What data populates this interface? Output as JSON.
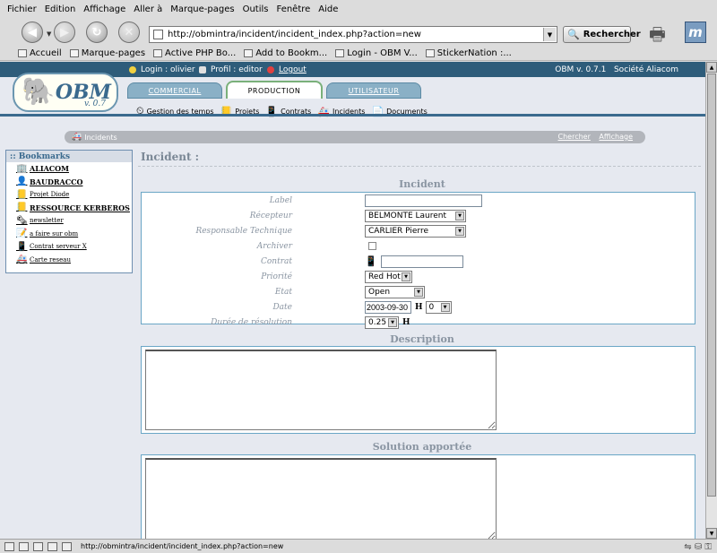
{
  "browser": {
    "menu": [
      "Fichier",
      "Edition",
      "Affichage",
      "Aller à",
      "Marque-pages",
      "Outils",
      "Fenêtre",
      "Aide"
    ],
    "url": "http://obmintra/incident/incident_index.php?action=new",
    "search_label": "Rechercher",
    "bookmarks": [
      "Accueil",
      "Marque-pages",
      "Active PHP Bo...",
      "Add to Bookm...",
      "Login - OBM V...",
      "StickerNation :..."
    ],
    "status_url": "http://obmintra/incident/incident_index.php?action=new"
  },
  "obm": {
    "login": "Login : olivier",
    "profil": "Profil : editor",
    "logout": "Logout",
    "version": "OBM v. 0.7.1",
    "company": "Société Aliacom",
    "logo_text": "OBM",
    "logo_version": "v. 0.7",
    "tabs": [
      "COMMERCIAL",
      "PRODUCTION",
      "UTILISATEUR"
    ],
    "subnav": [
      "Gestion des temps",
      "Projets",
      "Contrats",
      "Incidents",
      "Documents"
    ]
  },
  "breadcrumb": {
    "current": "Incidents",
    "actions": [
      "Chercher",
      "Affichage"
    ]
  },
  "bookmarks_panel": {
    "title": ":: Bookmarks",
    "items": [
      "ALIACOM",
      "BAUDRACCO",
      "Projet Diode",
      "RESSOURCE KERBEROS",
      "newsletter",
      "a faire sur obm",
      "Contrat serveur X",
      "Carte reseau"
    ]
  },
  "main": {
    "title": "Incident :",
    "section_incident": "Incident",
    "section_description": "Description",
    "section_solution": "Solution apportée",
    "fields": {
      "label": {
        "label": "Label",
        "value": ""
      },
      "recepteur": {
        "label": "Récepteur",
        "value": "BELMONTE Laurent"
      },
      "responsable": {
        "label": "Responsable Technique",
        "value": "CARLIER Pierre"
      },
      "archiver": {
        "label": "Archiver",
        "checked": false
      },
      "contrat": {
        "label": "Contrat",
        "value": ""
      },
      "priorite": {
        "label": "Priorité",
        "value": "Red Hot"
      },
      "etat": {
        "label": "Etat",
        "value": "Open"
      },
      "date": {
        "label": "Date",
        "value": "2003-09-30",
        "hour": "0",
        "unit": "H"
      },
      "duree": {
        "label": "Durée de résolution",
        "value": "0.25",
        "unit": "H"
      }
    }
  }
}
